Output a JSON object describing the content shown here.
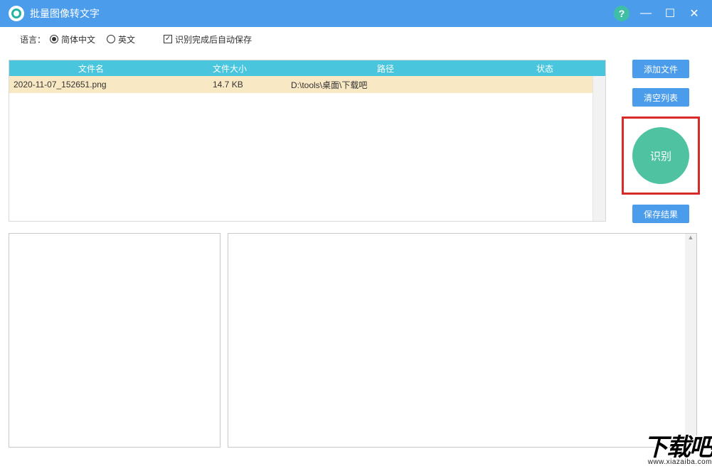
{
  "window": {
    "title": "批量图像转文字"
  },
  "toolbar": {
    "language_label": "语言：",
    "radio_zh": "简体中文",
    "radio_en": "英文",
    "autosave": "识别完成后自动保存",
    "language_selected": "zh",
    "autosave_checked": true
  },
  "table": {
    "columns": {
      "name": "文件名",
      "size": "文件大小",
      "path": "路径",
      "status": "状态"
    },
    "rows": [
      {
        "name": "2020-11-07_152651.png",
        "size": "14.7 KB",
        "path": "D:\\tools\\桌面\\下载吧",
        "status": ""
      }
    ]
  },
  "side": {
    "add_file": "添加文件",
    "clear_list": "清空列表",
    "recognize": "识别",
    "save_result": "保存结果"
  },
  "watermark": {
    "big": "下载吧",
    "small": "www.xiazaiba.com"
  }
}
